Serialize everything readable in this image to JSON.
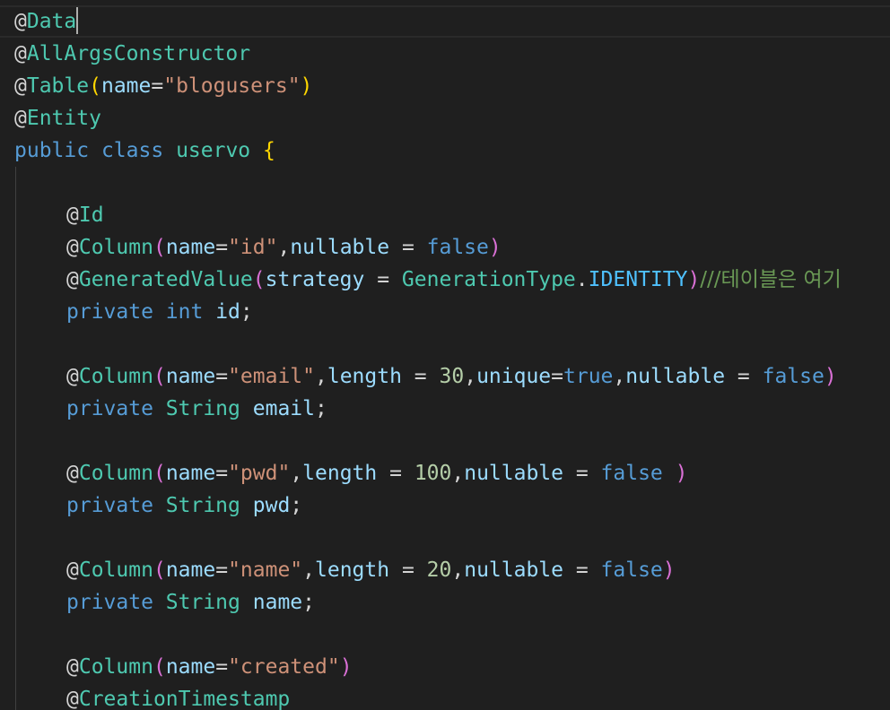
{
  "editor": {
    "theme_colors": {
      "background": "#1f1f1f",
      "annotation": "#4ec9b0",
      "keyword": "#569cd6",
      "string": "#ce9178",
      "variable": "#9cdcfe",
      "number": "#b5cea8",
      "comment": "#6a9955",
      "bracket_level1": "#ffd700",
      "bracket_level2": "#da70d6",
      "bracket_level3": "#179fff"
    },
    "cursor": {
      "line": 1,
      "after_text": "@Data"
    },
    "lines": [
      {
        "indent": 0,
        "tokens": [
          {
            "t": "@",
            "c": "pl"
          },
          {
            "t": "Data",
            "c": "anno"
          }
        ]
      },
      {
        "indent": 0,
        "tokens": [
          {
            "t": "@",
            "c": "pl"
          },
          {
            "t": "AllArgsConstructor",
            "c": "anno"
          }
        ]
      },
      {
        "indent": 0,
        "tokens": [
          {
            "t": "@",
            "c": "pl"
          },
          {
            "t": "Table",
            "c": "anno"
          },
          {
            "t": "(",
            "c": "br1"
          },
          {
            "t": "name",
            "c": "var"
          },
          {
            "t": "=",
            "c": "p"
          },
          {
            "t": "\"blogusers\"",
            "c": "str"
          },
          {
            "t": ")",
            "c": "br1"
          }
        ]
      },
      {
        "indent": 0,
        "tokens": [
          {
            "t": "@",
            "c": "pl"
          },
          {
            "t": "Entity",
            "c": "anno"
          }
        ]
      },
      {
        "indent": 0,
        "tokens": [
          {
            "t": "public",
            "c": "kw"
          },
          {
            "t": " ",
            "c": "p"
          },
          {
            "t": "class",
            "c": "kw"
          },
          {
            "t": " ",
            "c": "p"
          },
          {
            "t": "uservo",
            "c": "type"
          },
          {
            "t": " ",
            "c": "p"
          },
          {
            "t": "{",
            "c": "br1"
          }
        ]
      },
      {
        "indent": 0,
        "tokens": []
      },
      {
        "indent": 1,
        "tokens": [
          {
            "t": "@",
            "c": "pl"
          },
          {
            "t": "Id",
            "c": "anno"
          }
        ]
      },
      {
        "indent": 1,
        "tokens": [
          {
            "t": "@",
            "c": "pl"
          },
          {
            "t": "Column",
            "c": "anno"
          },
          {
            "t": "(",
            "c": "br2"
          },
          {
            "t": "name",
            "c": "var"
          },
          {
            "t": "=",
            "c": "p"
          },
          {
            "t": "\"id\"",
            "c": "str"
          },
          {
            "t": ",",
            "c": "p"
          },
          {
            "t": "nullable",
            "c": "var"
          },
          {
            "t": " = ",
            "c": "p"
          },
          {
            "t": "false",
            "c": "kw"
          },
          {
            "t": ")",
            "c": "br2"
          }
        ]
      },
      {
        "indent": 1,
        "tokens": [
          {
            "t": "@",
            "c": "pl"
          },
          {
            "t": "GeneratedValue",
            "c": "anno"
          },
          {
            "t": "(",
            "c": "br2"
          },
          {
            "t": "strategy",
            "c": "var"
          },
          {
            "t": " = ",
            "c": "p"
          },
          {
            "t": "GenerationType",
            "c": "type"
          },
          {
            "t": ".",
            "c": "p"
          },
          {
            "t": "IDENTITY",
            "c": "const"
          },
          {
            "t": ")",
            "c": "br2"
          },
          {
            "t": "///테이블은 여기",
            "c": "cm"
          }
        ]
      },
      {
        "indent": 1,
        "tokens": [
          {
            "t": "private",
            "c": "kw"
          },
          {
            "t": " ",
            "c": "p"
          },
          {
            "t": "int",
            "c": "kw"
          },
          {
            "t": " ",
            "c": "p"
          },
          {
            "t": "id",
            "c": "var"
          },
          {
            "t": ";",
            "c": "p"
          }
        ]
      },
      {
        "indent": 1,
        "tokens": []
      },
      {
        "indent": 1,
        "tokens": [
          {
            "t": "@",
            "c": "pl"
          },
          {
            "t": "Column",
            "c": "anno"
          },
          {
            "t": "(",
            "c": "br2"
          },
          {
            "t": "name",
            "c": "var"
          },
          {
            "t": "=",
            "c": "p"
          },
          {
            "t": "\"email\"",
            "c": "str"
          },
          {
            "t": ",",
            "c": "p"
          },
          {
            "t": "length",
            "c": "var"
          },
          {
            "t": " = ",
            "c": "p"
          },
          {
            "t": "30",
            "c": "num"
          },
          {
            "t": ",",
            "c": "p"
          },
          {
            "t": "unique",
            "c": "var"
          },
          {
            "t": "=",
            "c": "p"
          },
          {
            "t": "true",
            "c": "kw"
          },
          {
            "t": ",",
            "c": "p"
          },
          {
            "t": "nullable",
            "c": "var"
          },
          {
            "t": " = ",
            "c": "p"
          },
          {
            "t": "false",
            "c": "kw"
          },
          {
            "t": ")",
            "c": "br2"
          }
        ]
      },
      {
        "indent": 1,
        "tokens": [
          {
            "t": "private",
            "c": "kw"
          },
          {
            "t": " ",
            "c": "p"
          },
          {
            "t": "String",
            "c": "type"
          },
          {
            "t": " ",
            "c": "p"
          },
          {
            "t": "email",
            "c": "var"
          },
          {
            "t": ";",
            "c": "p"
          }
        ]
      },
      {
        "indent": 1,
        "tokens": []
      },
      {
        "indent": 1,
        "tokens": [
          {
            "t": "@",
            "c": "pl"
          },
          {
            "t": "Column",
            "c": "anno"
          },
          {
            "t": "(",
            "c": "br2"
          },
          {
            "t": "name",
            "c": "var"
          },
          {
            "t": "=",
            "c": "p"
          },
          {
            "t": "\"pwd\"",
            "c": "str"
          },
          {
            "t": ",",
            "c": "p"
          },
          {
            "t": "length",
            "c": "var"
          },
          {
            "t": " = ",
            "c": "p"
          },
          {
            "t": "100",
            "c": "num"
          },
          {
            "t": ",",
            "c": "p"
          },
          {
            "t": "nullable",
            "c": "var"
          },
          {
            "t": " = ",
            "c": "p"
          },
          {
            "t": "false",
            "c": "kw"
          },
          {
            "t": " ",
            "c": "p"
          },
          {
            "t": ")",
            "c": "br2"
          }
        ]
      },
      {
        "indent": 1,
        "tokens": [
          {
            "t": "private",
            "c": "kw"
          },
          {
            "t": " ",
            "c": "p"
          },
          {
            "t": "String",
            "c": "type"
          },
          {
            "t": " ",
            "c": "p"
          },
          {
            "t": "pwd",
            "c": "var"
          },
          {
            "t": ";",
            "c": "p"
          }
        ]
      },
      {
        "indent": 1,
        "tokens": []
      },
      {
        "indent": 1,
        "tokens": [
          {
            "t": "@",
            "c": "pl"
          },
          {
            "t": "Column",
            "c": "anno"
          },
          {
            "t": "(",
            "c": "br2"
          },
          {
            "t": "name",
            "c": "var"
          },
          {
            "t": "=",
            "c": "p"
          },
          {
            "t": "\"name\"",
            "c": "str"
          },
          {
            "t": ",",
            "c": "p"
          },
          {
            "t": "length",
            "c": "var"
          },
          {
            "t": " = ",
            "c": "p"
          },
          {
            "t": "20",
            "c": "num"
          },
          {
            "t": ",",
            "c": "p"
          },
          {
            "t": "nullable",
            "c": "var"
          },
          {
            "t": " = ",
            "c": "p"
          },
          {
            "t": "false",
            "c": "kw"
          },
          {
            "t": ")",
            "c": "br2"
          }
        ]
      },
      {
        "indent": 1,
        "tokens": [
          {
            "t": "private",
            "c": "kw"
          },
          {
            "t": " ",
            "c": "p"
          },
          {
            "t": "String",
            "c": "type"
          },
          {
            "t": " ",
            "c": "p"
          },
          {
            "t": "name",
            "c": "var"
          },
          {
            "t": ";",
            "c": "p"
          }
        ]
      },
      {
        "indent": 1,
        "tokens": []
      },
      {
        "indent": 1,
        "tokens": [
          {
            "t": "@",
            "c": "pl"
          },
          {
            "t": "Column",
            "c": "anno"
          },
          {
            "t": "(",
            "c": "br2"
          },
          {
            "t": "name",
            "c": "var"
          },
          {
            "t": "=",
            "c": "p"
          },
          {
            "t": "\"created\"",
            "c": "str"
          },
          {
            "t": ")",
            "c": "br2"
          }
        ]
      },
      {
        "indent": 1,
        "tokens": [
          {
            "t": "@",
            "c": "pl"
          },
          {
            "t": "CreationTimestamp",
            "c": "anno"
          }
        ]
      }
    ]
  }
}
